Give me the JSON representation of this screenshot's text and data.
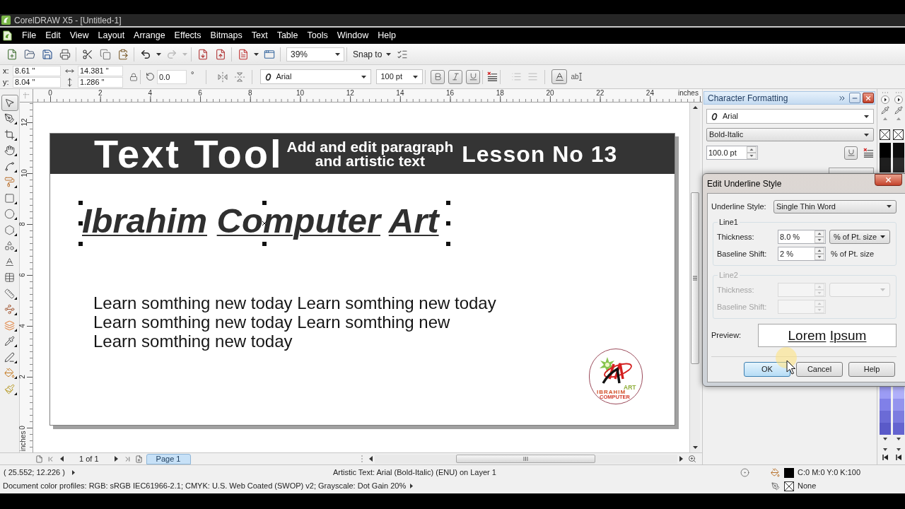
{
  "window": {
    "title": "CorelDRAW X5 - [Untitled-1]"
  },
  "menu": [
    {
      "label": "File"
    },
    {
      "label": "Edit"
    },
    {
      "label": "View"
    },
    {
      "label": "Layout"
    },
    {
      "label": "Arrange"
    },
    {
      "label": "Effects"
    },
    {
      "label": "Bitmaps"
    },
    {
      "label": "Text"
    },
    {
      "label": "Table"
    },
    {
      "label": "Tools"
    },
    {
      "label": "Window"
    },
    {
      "label": "Help"
    }
  ],
  "standard_toolbar": {
    "undo": {
      "disabled": false
    },
    "redo": {
      "disabled": true
    },
    "zoom": "39%",
    "snap_to": "Snap to"
  },
  "property_bar": {
    "x_label": "x:",
    "x": "8.61 \"",
    "y_label": "y:",
    "y": "8.04 \"",
    "width": "14.381 \"",
    "height": "1.286 \"",
    "rotation": "0.0",
    "degree": "°",
    "font": "Arial",
    "size": "100 pt",
    "styles": [
      {
        "kind": "bold",
        "selected": true
      },
      {
        "kind": "italic",
        "selected": true
      },
      {
        "kind": "underline",
        "selected": true
      }
    ],
    "text_frame": {
      "selected": true
    },
    "edit_text": "ab"
  },
  "rulers": {
    "horizontal": [
      "0",
      "2",
      "4",
      "6",
      "8",
      "10",
      "12",
      "14",
      "16",
      "18",
      "20",
      "22",
      "24"
    ],
    "horizontal_unit": "inches",
    "vertical": [
      "12",
      "10",
      "8",
      "6",
      "4",
      "2",
      "0"
    ],
    "vertical_unit": "inches"
  },
  "toolbox": [
    {
      "kind": "pick",
      "selected": true,
      "flyout": false
    },
    {
      "kind": "shape",
      "selected": false,
      "flyout": true
    },
    {
      "kind": "crop",
      "selected": false,
      "flyout": true
    },
    {
      "kind": "pan",
      "selected": false,
      "flyout": true
    },
    {
      "kind": "freehand",
      "selected": false,
      "flyout": true
    },
    {
      "kind": "smartfill",
      "selected": false,
      "flyout": true
    },
    {
      "kind": "rectangle",
      "selected": false,
      "flyout": true
    },
    {
      "kind": "ellipse",
      "selected": false,
      "flyout": true
    },
    {
      "kind": "polygon",
      "selected": false,
      "flyout": true
    },
    {
      "kind": "shapes",
      "selected": false,
      "flyout": true
    },
    {
      "kind": "text",
      "selected": false,
      "flyout": false
    },
    {
      "kind": "table",
      "selected": false,
      "flyout": false
    },
    {
      "kind": "dimension",
      "selected": false,
      "flyout": true
    },
    {
      "kind": "connector",
      "selected": false,
      "flyout": true
    },
    {
      "kind": "blend",
      "selected": false,
      "flyout": true
    },
    {
      "kind": "eyedropper",
      "selected": false,
      "flyout": true
    },
    {
      "kind": "outline",
      "selected": false,
      "flyout": true
    },
    {
      "kind": "fill",
      "selected": false,
      "flyout": true
    },
    {
      "kind": "interactive",
      "selected": false,
      "flyout": true
    }
  ],
  "page": {
    "banner": {
      "title": "Text Tool",
      "subtitle": [
        "Add and edit paragraph",
        "and artistic text"
      ],
      "lesson": "Lesson No 13"
    },
    "artistic_text": {
      "text": "Ibrahim Computer Art",
      "selected": true
    },
    "paragraph": [
      "Learn somthing new today Learn somthing new today",
      "Learn somthing new today Learn somthing new",
      "Learn somthing new today"
    ],
    "logo": {
      "name": "IBRAHIM",
      "tag": "ART",
      "subtitle": "COMPUTER"
    }
  },
  "docker": {
    "title": "Character Formatting",
    "font": "Arial",
    "style": "Bold-Italic",
    "size": "100.0 pt",
    "underline": {
      "selected": true
    }
  },
  "palettes": [
    {
      "top": [
        {
          "color": "#000000"
        },
        {
          "color": "#1e1e1e"
        }
      ],
      "bottom": [
        {
          "color": "#9c9cf5"
        },
        {
          "color": "#8080e8"
        },
        {
          "color": "#6b6bd6"
        },
        {
          "color": "#5a5ac8"
        }
      ]
    },
    {
      "top": [
        {
          "color": "#0d0d0d"
        },
        {
          "color": "#2a2a2a"
        }
      ],
      "bottom": [
        {
          "color": "#b0b0fa"
        },
        {
          "color": "#9494ee"
        },
        {
          "color": "#7c7ce0"
        },
        {
          "color": "#6464d0"
        }
      ]
    }
  ],
  "dialog": {
    "title": "Edit Underline Style",
    "underline_style_label": "Underline Style:",
    "underline_style": "Single Thin Word",
    "groups": [
      {
        "legend": "Line1",
        "disabled": false,
        "thickness_label": "Thickness:",
        "thickness": "8.0 %",
        "thickness_unit": "% of Pt. size",
        "baseline_label": "Baseline Shift:",
        "baseline": "2 %",
        "baseline_unit": "% of Pt. size"
      },
      {
        "legend": "Line2",
        "disabled": true,
        "thickness_label": "Thickness:",
        "baseline_label": "Baseline Shift:"
      }
    ],
    "preview_label": "Preview:",
    "preview": "Lorem Ipsum",
    "buttons": [
      {
        "label": "OK",
        "focused": true
      },
      {
        "label": "Cancel",
        "focused": false
      },
      {
        "label": "Help",
        "focused": false
      }
    ]
  },
  "page_nav": {
    "count": "1 of 1",
    "tabs": [
      {
        "label": "Page 1",
        "selected": true
      }
    ]
  },
  "status_bar": {
    "coordinates": "( 25.552; 12.226 )",
    "object_info": "Artistic Text: Arial (Bold-Italic) (ENU) on Layer 1",
    "color_profiles": "Document color profiles: RGB: sRGB IEC61966-2.1; CMYK: U.S. Web Coated (SWOP) v2; Grayscale: Dot Gain 20%",
    "fill": {
      "color": "#000000",
      "label": "C:0 M:0 Y:0 K:100"
    },
    "outline": {
      "label": "None"
    }
  }
}
